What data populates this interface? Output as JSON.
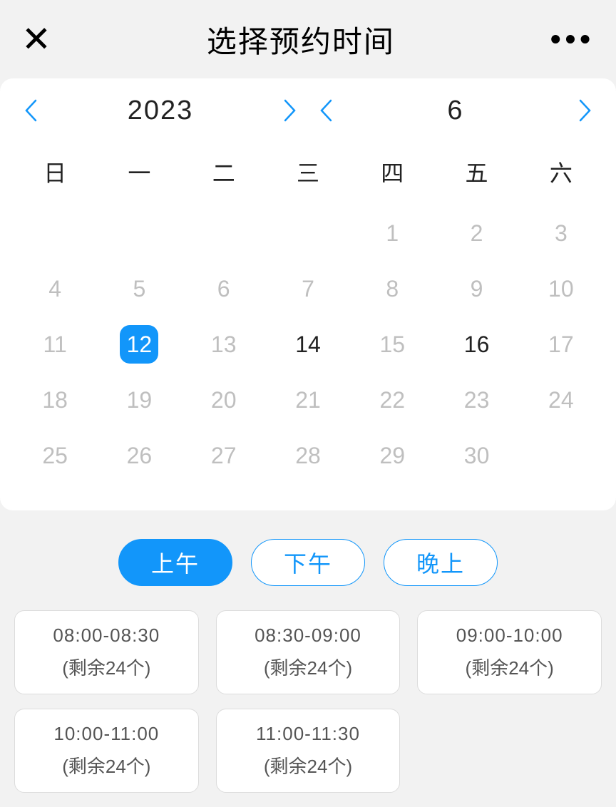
{
  "header": {
    "title": "选择预约时间"
  },
  "calendar": {
    "year": "2023",
    "month": "6",
    "weekdays": [
      "日",
      "一",
      "二",
      "三",
      "四",
      "五",
      "六"
    ],
    "weeks": [
      [
        {
          "num": "",
          "state": "empty"
        },
        {
          "num": "",
          "state": "empty"
        },
        {
          "num": "",
          "state": "empty"
        },
        {
          "num": "",
          "state": "empty"
        },
        {
          "num": "1",
          "state": "disabled"
        },
        {
          "num": "2",
          "state": "disabled"
        },
        {
          "num": "3",
          "state": "disabled"
        }
      ],
      [
        {
          "num": "4",
          "state": "disabled"
        },
        {
          "num": "5",
          "state": "disabled"
        },
        {
          "num": "6",
          "state": "disabled"
        },
        {
          "num": "7",
          "state": "disabled"
        },
        {
          "num": "8",
          "state": "disabled"
        },
        {
          "num": "9",
          "state": "disabled"
        },
        {
          "num": "10",
          "state": "disabled"
        }
      ],
      [
        {
          "num": "11",
          "state": "disabled"
        },
        {
          "num": "12",
          "state": "selected"
        },
        {
          "num": "13",
          "state": "disabled"
        },
        {
          "num": "14",
          "state": "available"
        },
        {
          "num": "15",
          "state": "disabled"
        },
        {
          "num": "16",
          "state": "available"
        },
        {
          "num": "17",
          "state": "disabled"
        }
      ],
      [
        {
          "num": "18",
          "state": "disabled"
        },
        {
          "num": "19",
          "state": "disabled"
        },
        {
          "num": "20",
          "state": "disabled"
        },
        {
          "num": "21",
          "state": "disabled"
        },
        {
          "num": "22",
          "state": "disabled"
        },
        {
          "num": "23",
          "state": "disabled"
        },
        {
          "num": "24",
          "state": "disabled"
        }
      ],
      [
        {
          "num": "25",
          "state": "disabled"
        },
        {
          "num": "26",
          "state": "disabled"
        },
        {
          "num": "27",
          "state": "disabled"
        },
        {
          "num": "28",
          "state": "disabled"
        },
        {
          "num": "29",
          "state": "disabled"
        },
        {
          "num": "30",
          "state": "disabled"
        },
        {
          "num": "",
          "state": "empty"
        }
      ]
    ]
  },
  "periods": [
    {
      "label": "上午",
      "active": true
    },
    {
      "label": "下午",
      "active": false
    },
    {
      "label": "晚上",
      "active": false
    }
  ],
  "slots": [
    {
      "time": "08:00-08:30",
      "remain": "(剩余24个)"
    },
    {
      "time": "08:30-09:00",
      "remain": "(剩余24个)"
    },
    {
      "time": "09:00-10:00",
      "remain": "(剩余24个)"
    },
    {
      "time": "10:00-11:00",
      "remain": "(剩余24个)"
    },
    {
      "time": "11:00-11:30",
      "remain": "(剩余24个)"
    }
  ],
  "colors": {
    "accent": "#1296fa"
  }
}
